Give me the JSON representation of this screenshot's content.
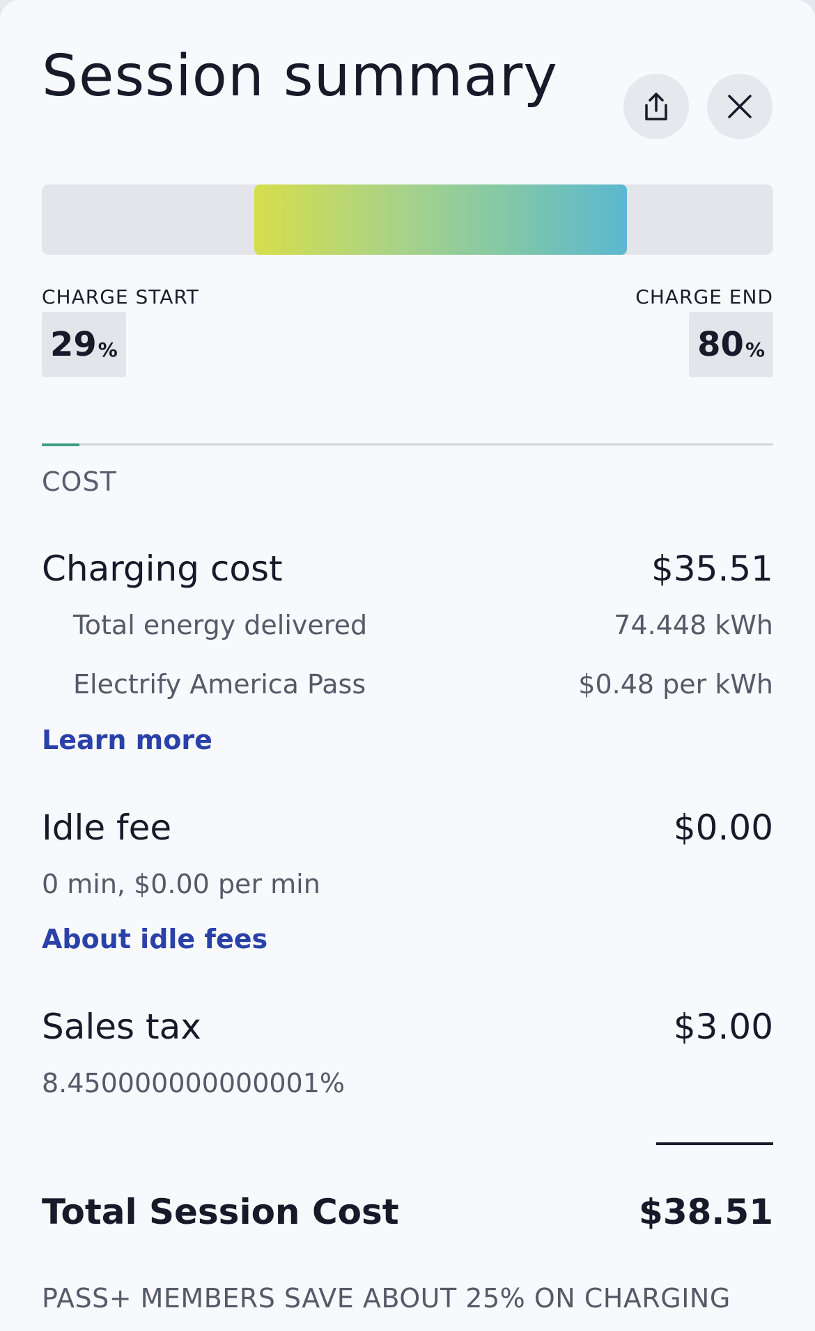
{
  "header": {
    "title": "Session summary",
    "share_icon": "share-icon",
    "close_icon": "close-icon"
  },
  "charge": {
    "start_label": "CHARGE START",
    "end_label": "CHARGE END",
    "start_value": "29",
    "end_value": "80",
    "unit": "%",
    "start_fraction": 0.29,
    "end_fraction": 0.8,
    "gradient_colors": [
      "#d6de4c",
      "#5ab8cf"
    ]
  },
  "cost": {
    "section_label": "COST",
    "charging": {
      "label": "Charging cost",
      "value": "$35.51",
      "energy_label": "Total energy delivered",
      "energy_value": "74.448 kWh",
      "plan_label": "Electrify America Pass",
      "plan_value": "$0.48 per kWh",
      "link": "Learn more"
    },
    "idle": {
      "label": "Idle fee",
      "value": "$0.00",
      "detail": "0 min, $0.00 per min",
      "link": "About idle fees"
    },
    "tax": {
      "label": "Sales tax",
      "value": "$3.00",
      "detail": "8.450000000000001%"
    },
    "total": {
      "label": "Total Session Cost",
      "value": "$38.51"
    }
  },
  "promo": "PASS+ MEMBERS SAVE ABOUT 25% ON CHARGING",
  "colors": {
    "link": "#2a41a8",
    "accent": "#3f9e86",
    "background": "#f8f9fc"
  }
}
